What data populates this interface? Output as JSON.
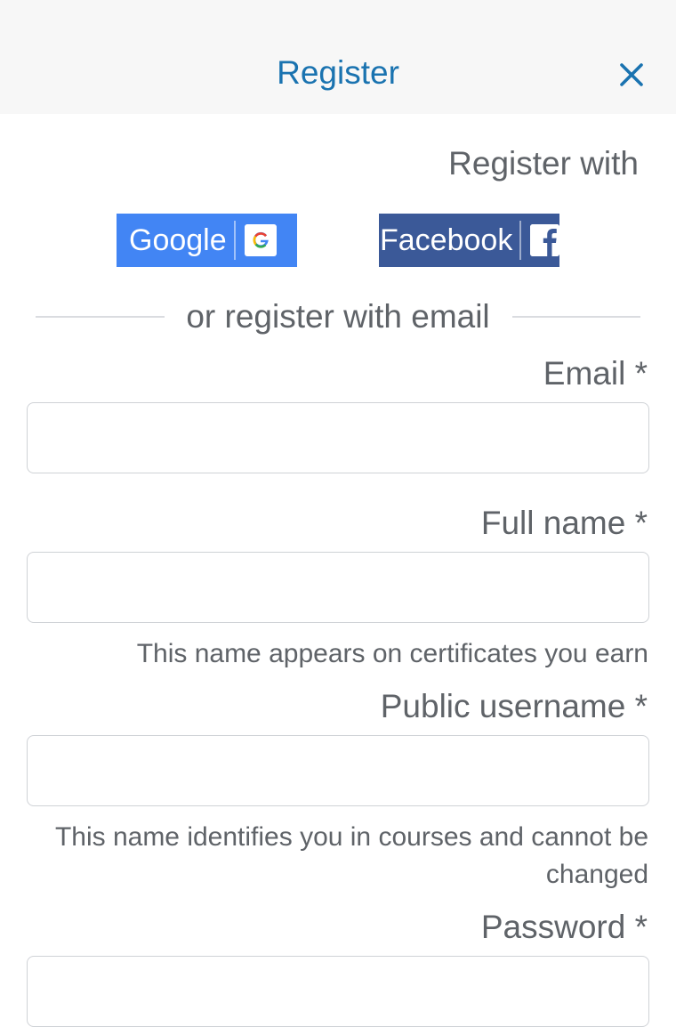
{
  "header": {
    "title": "Register",
    "close_icon": "close-icon",
    "title_color": "#1a73b0"
  },
  "social": {
    "heading": "Register with",
    "google_label": "Google",
    "google_badge_letter": "G",
    "google_color": "#4285f4",
    "facebook_label": "Facebook",
    "facebook_badge_letter": "f",
    "facebook_color": "#3b5998"
  },
  "divider": {
    "text": "or register with email"
  },
  "form": {
    "email": {
      "label": "Email *",
      "value": "",
      "placeholder": ""
    },
    "full_name": {
      "label": "Full name *",
      "value": "",
      "placeholder": "",
      "help": "This name appears on certificates you earn"
    },
    "username": {
      "label": "Public username *",
      "value": "",
      "placeholder": "",
      "help": "This name identifies you in courses and cannot be changed"
    },
    "password": {
      "label": "Password *",
      "value": "",
      "placeholder": ""
    }
  }
}
